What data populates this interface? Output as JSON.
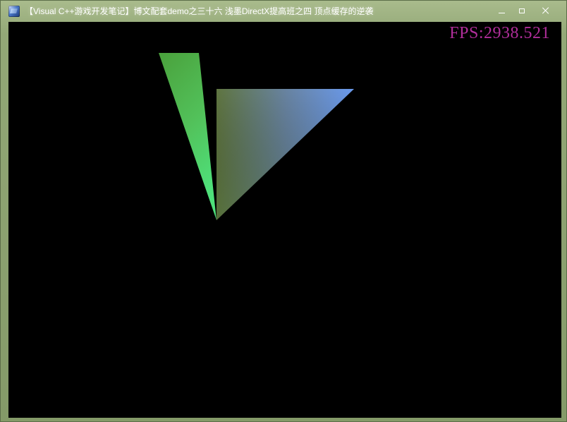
{
  "window": {
    "title": "【Visual C++游戏开发笔记】博文配套demo之三十六 浅墨DirectX提高班之四 顶点缓存的逆袭",
    "icon": "directx-app-icon",
    "controls": {
      "minimize": "minimize-icon",
      "maximize": "maximize-icon",
      "close": "close-icon"
    }
  },
  "overlay": {
    "fps_text": "FPS:2938.521",
    "fps_color": "#b02e9a"
  },
  "scene": {
    "background": "#000000",
    "triangles": [
      {
        "name": "narrow-green-triangle",
        "colors": [
          "#4aa13c",
          "#53b04a",
          "#4fe07a"
        ]
      },
      {
        "name": "wide-gradient-triangle",
        "colors": [
          "#60783e",
          "#6a9aee",
          "#5a7a46"
        ]
      }
    ]
  },
  "colors": {
    "window_frame": "#8ba06f",
    "client_area": "#000000"
  }
}
